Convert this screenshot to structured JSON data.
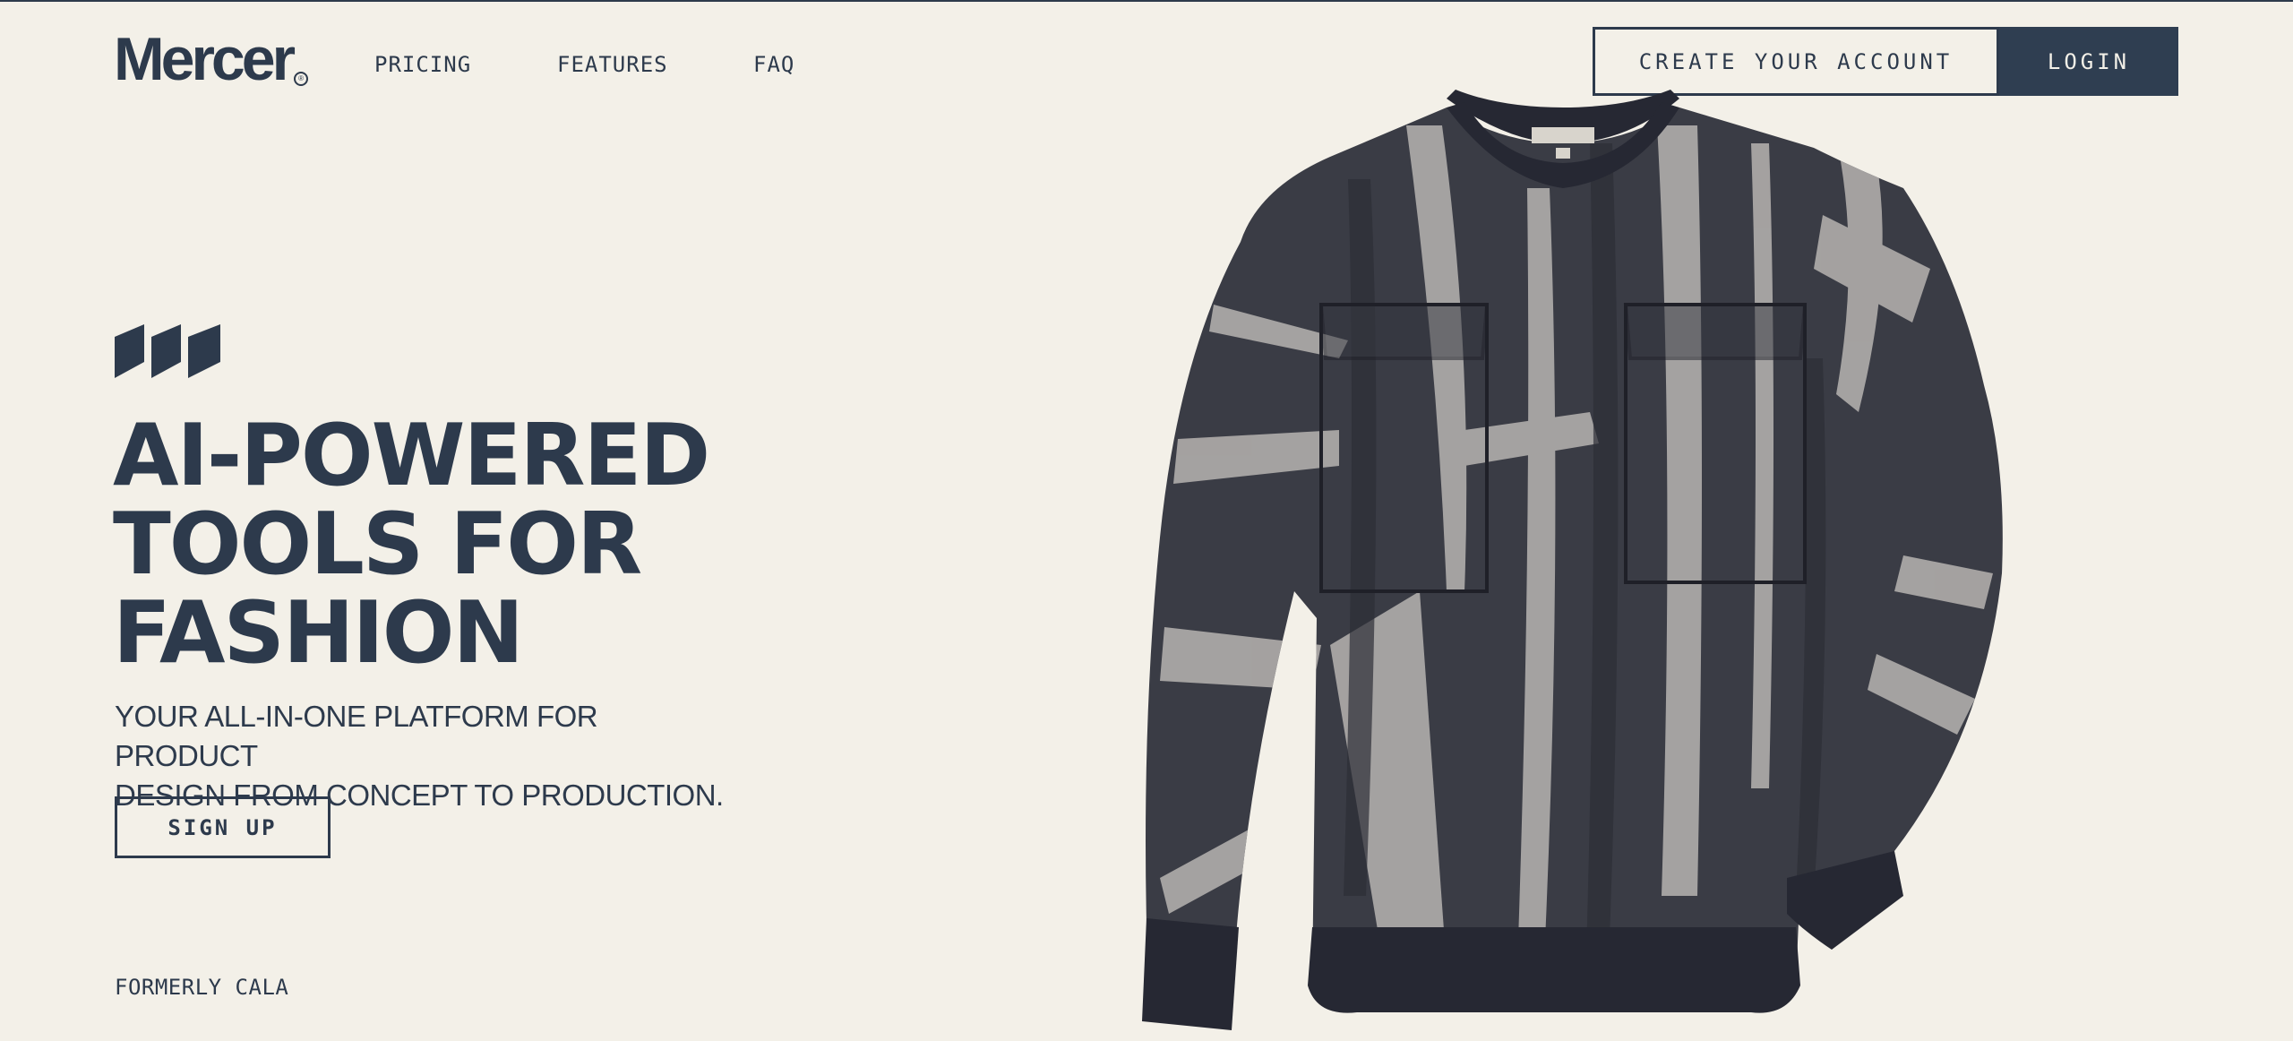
{
  "brand": {
    "name": "Mercer",
    "mark": "®"
  },
  "nav": {
    "links": [
      "PRICING",
      "FEATURES",
      "FAQ"
    ],
    "create_account": "CREATE YOUR ACCOUNT",
    "login": "LOGIN"
  },
  "hero": {
    "headline": [
      "AI-POWERED",
      "TOOLS FOR",
      "FASHION"
    ],
    "subtitle": [
      "YOUR ALL-IN-ONE PLATFORM FOR PRODUCT",
      "DESIGN FROM CONCEPT TO PRODUCTION."
    ],
    "signup": "SIGN UP",
    "formerly": "FORMERLY CALA"
  },
  "colors": {
    "background": "#f3f0e8",
    "text": "#2d3a4c",
    "login_bg": "#2f3e51"
  },
  "image": {
    "subject": "tie-dye-sweatshirt"
  }
}
